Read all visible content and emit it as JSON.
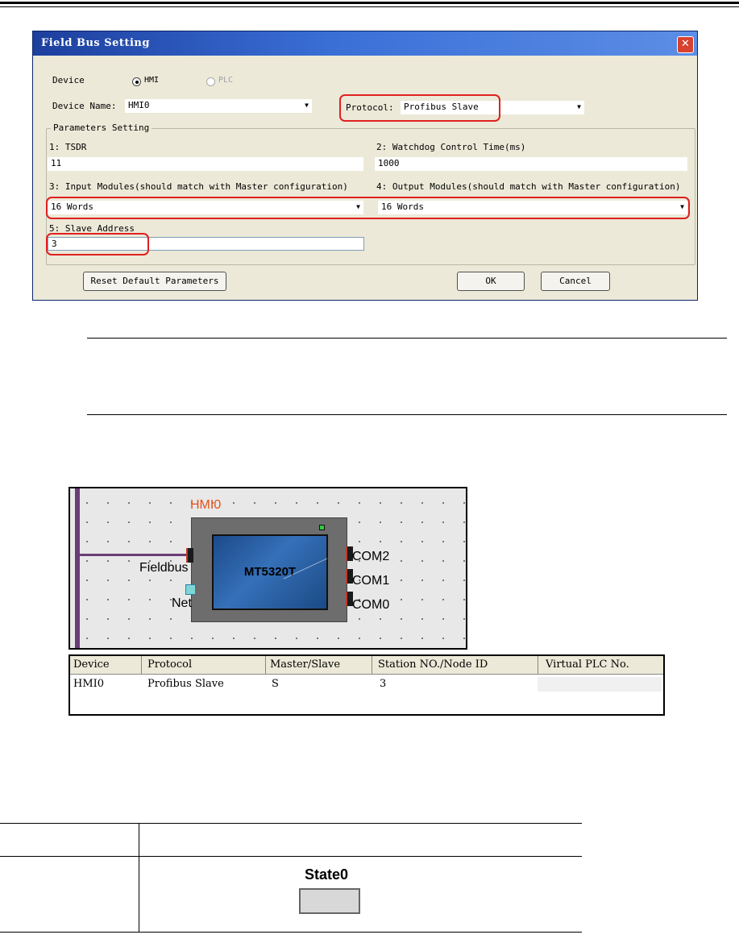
{
  "dialog": {
    "title": "Field Bus Setting",
    "close_glyph": "✕",
    "device_label": "Device",
    "device_options": [
      "HMI",
      "PLC"
    ],
    "device_selected": "HMI",
    "device_name_label": "Device Name:",
    "device_name_value": "HMI0",
    "protocol_label": "Protocol:",
    "protocol_value": "Profibus Slave",
    "params_group": "Parameters Setting",
    "p1_label": "1: TSDR",
    "p1_value": "11",
    "p2_label": "2: Watchdog Control Time(ms)",
    "p2_value": "1000",
    "p3_label": "3: Input Modules(should match with Master configuration)",
    "p3_value": "16 Words",
    "p4_label": "4: Output Modules(should match with Master configuration)",
    "p4_value": "16 Words",
    "p5_label": "5: Slave Address",
    "p5_value": "3",
    "reset_button": "Reset Default Parameters",
    "ok_button": "OK",
    "cancel_button": "Cancel"
  },
  "diagram": {
    "hmi_name": "HMI0",
    "model": "MT5320T",
    "fieldbus_label": "Fieldbus",
    "net_label": "Net",
    "ports": [
      "COM2",
      "COM1",
      "COM0"
    ]
  },
  "device_table": {
    "headers": [
      "Device",
      "Protocol",
      "Master/Slave",
      "Station NO./Node ID",
      "Virtual PLC No."
    ],
    "rows": [
      [
        "HMI0",
        "Profibus Slave",
        "S",
        "3",
        ""
      ]
    ]
  },
  "state_table": {
    "state_label": "State0"
  },
  "colors": {
    "title_bar": "#3a6fd6",
    "highlight": "#e02020",
    "fieldbus_line": "#6a3d77",
    "hmi_label": "#e2521a"
  }
}
